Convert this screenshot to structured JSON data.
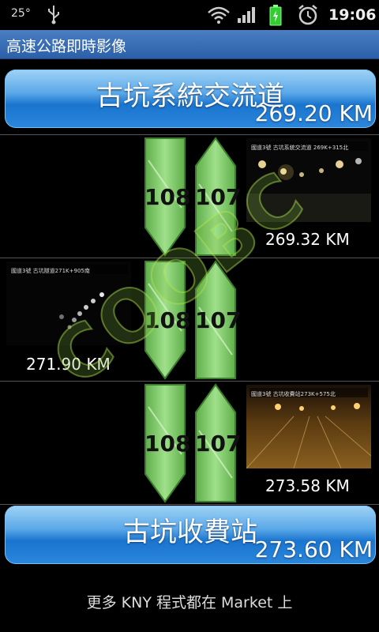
{
  "status_bar": {
    "temperature": "25°",
    "time": "19:06",
    "icons": [
      "usb-icon",
      "wifi-icon",
      "signal-icon",
      "battery-icon",
      "alarm-icon"
    ]
  },
  "app_title": "高速公路即時影像",
  "top_interchange": {
    "name": "古坑系統交流道",
    "km": "269.20 KM"
  },
  "segments": [
    {
      "southbound": "108",
      "northbound": "107",
      "camera_km": "269.32 KM",
      "camera_caption": "國道3號 古坑系統交流道 269K+315北"
    },
    {
      "southbound": "108",
      "northbound": "107",
      "camera_km": "271.90 KM",
      "camera_caption": "國道3號 古坑隧道271K+905南"
    },
    {
      "southbound": "108",
      "northbound": "107",
      "camera_km": "273.58 KM",
      "camera_caption": "國道3號 古坑收費站273K+575北"
    }
  ],
  "bottom_station": {
    "name": "古坑收費站",
    "km": "273.60 KM"
  },
  "footer": "更多 KNY 程式都在 Market 上",
  "colors": {
    "arrow_green": "#8ed37a",
    "button_blue": "#2b86dc",
    "title_blue": "#3b6fb5"
  }
}
